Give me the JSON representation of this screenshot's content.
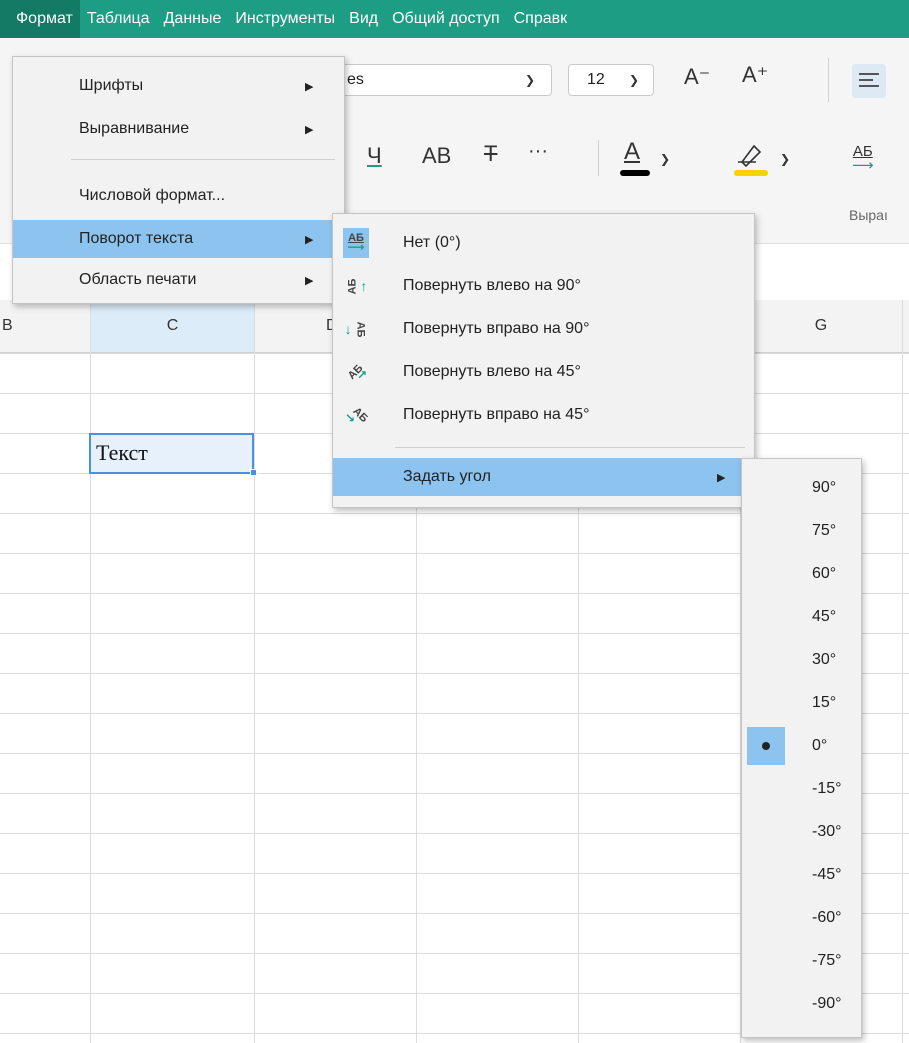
{
  "menubar": {
    "items": [
      "Формат",
      "Таблица",
      "Данные",
      "Инструменты",
      "Вид",
      "Общий доступ",
      "Справк"
    ]
  },
  "ribbon": {
    "font_name": "es",
    "font_size": "12",
    "decrease_font": "A⁻",
    "increase_font": "A⁺",
    "underline": "Ч",
    "caps": "АВ",
    "strike": "Т",
    "more": "···",
    "font_color_glyph": "A",
    "font_color": "#000000",
    "highlight_color": "#f5d300",
    "direction_glyph": "АБ",
    "group_label": "Выраı"
  },
  "sheet": {
    "columns": [
      "B",
      "C",
      "D",
      "G"
    ],
    "cell_text": "Текст"
  },
  "format_menu": {
    "items": [
      {
        "label": "Шрифты",
        "submenu": true
      },
      {
        "label": "Выравнивание",
        "submenu": true
      },
      {
        "label": "Числовой формат...",
        "submenu": false
      },
      {
        "label": "Поворот текста",
        "submenu": true
      },
      {
        "label": "Область печати",
        "submenu": true
      }
    ]
  },
  "rotation_menu": {
    "items": [
      {
        "label": "Нет (0°)",
        "icon": "rotate-none-icon",
        "selected": true
      },
      {
        "label": "Повернуть влево на 90°",
        "icon": "rotate-left-90-icon"
      },
      {
        "label": "Повернуть вправо на 90°",
        "icon": "rotate-right-90-icon"
      },
      {
        "label": "Повернуть влево на 45°",
        "icon": "rotate-left-45-icon"
      },
      {
        "label": "Повернуть вправо на 45°",
        "icon": "rotate-right-45-icon"
      }
    ],
    "icon_glyph": "АБ",
    "set_angle": "Задать угол"
  },
  "angle_menu": {
    "items": [
      "90°",
      "75°",
      "60°",
      "45°",
      "30°",
      "15°",
      "0°",
      "-15°",
      "-30°",
      "-45°",
      "-60°",
      "-75°",
      "-90°"
    ],
    "selected": "0°"
  },
  "colors": {
    "menubar": "#1c9d84",
    "menubar_active": "#137a66",
    "menu_highlight": "#8cc4ef",
    "cell_selection": "#4a90e2"
  }
}
